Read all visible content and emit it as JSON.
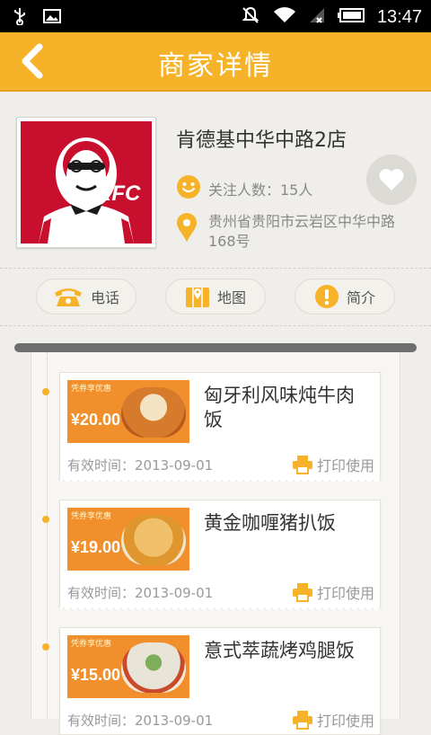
{
  "status_bar": {
    "time": "13:47"
  },
  "header": {
    "title": "商家详情"
  },
  "store": {
    "name": "肯德基中华中路2店",
    "logo_text": "KFC",
    "followers": "关注人数：15人",
    "address": "贵州省贵阳市云岩区中华中路168号"
  },
  "actions": [
    {
      "label": "电话"
    },
    {
      "label": "地图"
    },
    {
      "label": "简介"
    }
  ],
  "coupons": [
    {
      "title": "匈牙利风味炖牛肉饭",
      "valid": "有效时间：2013-09-01",
      "print": "打印使用",
      "price": "¥20.00",
      "tag": "凭券享优惠"
    },
    {
      "title": "黄金咖喱猪扒饭",
      "valid": "有效时间：2013-09-01",
      "print": "打印使用",
      "price": "¥19.00",
      "tag": "凭券享优惠"
    },
    {
      "title": "意式萃蔬烤鸡腿饭",
      "valid": "有效时间：2013-09-01",
      "print": "打印使用",
      "price": "¥15.00",
      "tag": "凭券享优惠"
    }
  ],
  "colors": {
    "accent": "#f6b32a",
    "kfc_red": "#c8102e"
  }
}
